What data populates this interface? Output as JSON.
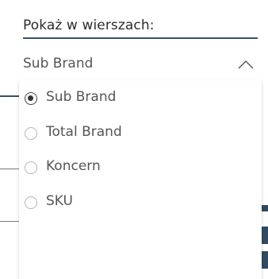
{
  "slicer": {
    "label": "Pokaż w wierszach:",
    "selected_value": "Sub Brand",
    "expanded_icon": "chevron-up-icon",
    "options": [
      {
        "label": "Sub Brand",
        "checked": true
      },
      {
        "label": "Total Brand",
        "checked": false
      },
      {
        "label": "Koncern",
        "checked": false
      },
      {
        "label": "SKU",
        "checked": false
      }
    ]
  },
  "colors": {
    "underline": "#3a4f66",
    "text": "#555555",
    "radio_border": "#b5b5b5",
    "radio_checked": "#333333",
    "background_bar": "#2f4a63"
  }
}
